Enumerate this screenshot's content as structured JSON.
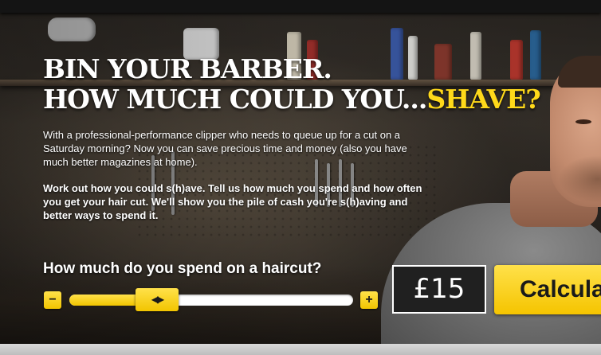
{
  "headline": {
    "line1": "BIN YOUR BARBER.",
    "line2_main": "HOW MUCH COULD YOU...",
    "line2_accent": "SHAVE?"
  },
  "intro": {
    "paragraph1": "With a professional-performance clipper who needs to queue up for a cut on a Saturday morning? Now you can save precious time and money (also you have much better magazines at home).",
    "paragraph2": "Work out how you could s(h)ave. Tell us how much you spend and how often you get your hair cut. We'll show you the pile of cash you're s(h)aving and better ways to spend it."
  },
  "calculator": {
    "question": "How much do you spend on a haircut?",
    "decrease_label": "−",
    "increase_label": "+",
    "slider_handle_label": "◀▶",
    "slider_level_percent": 31,
    "price_value": "£15",
    "calculate_label": "Calculate"
  },
  "colors": {
    "accent_yellow": "#ffd91a",
    "button_yellow": "#f5c400",
    "price_box_bg": "#202020"
  }
}
